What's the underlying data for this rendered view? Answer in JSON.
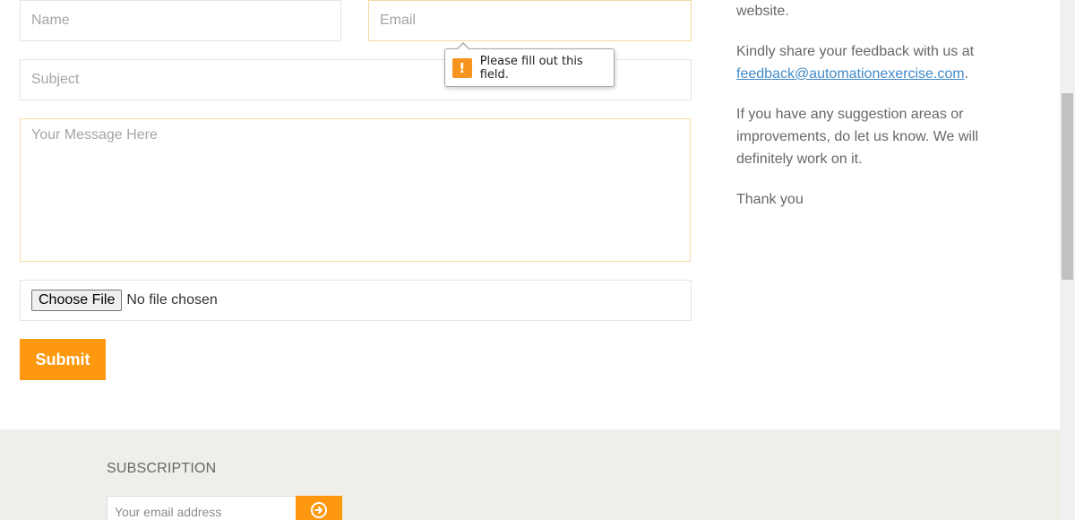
{
  "form": {
    "name_placeholder": "Name",
    "email_placeholder": "Email",
    "subject_placeholder": "Subject",
    "message_placeholder": "Your Message Here",
    "file_button_label": "Choose File",
    "file_status": "No file chosen",
    "submit_label": "Submit"
  },
  "validation_tooltip": {
    "icon": "warning-icon",
    "icon_glyph": "!",
    "text": "Please fill out this field."
  },
  "sidebar": {
    "p0": "website.",
    "p1_text": "Kindly share your feedback with us at",
    "p1_email": "feedback@automationexercise.com",
    "p1_suffix": ".",
    "p2": "If you have any suggestion areas or improvements, do let us know. We will definitely work on it.",
    "p3": "Thank you"
  },
  "footer": {
    "subscription_title": "SUBSCRIPTION",
    "email_placeholder": "Your email address",
    "subscribe_icon": "arrow-circle-right-icon"
  },
  "colors": {
    "accent": "#fe980f",
    "link": "#428bca",
    "footer_bg": "#efeee8",
    "text": "#696763"
  }
}
